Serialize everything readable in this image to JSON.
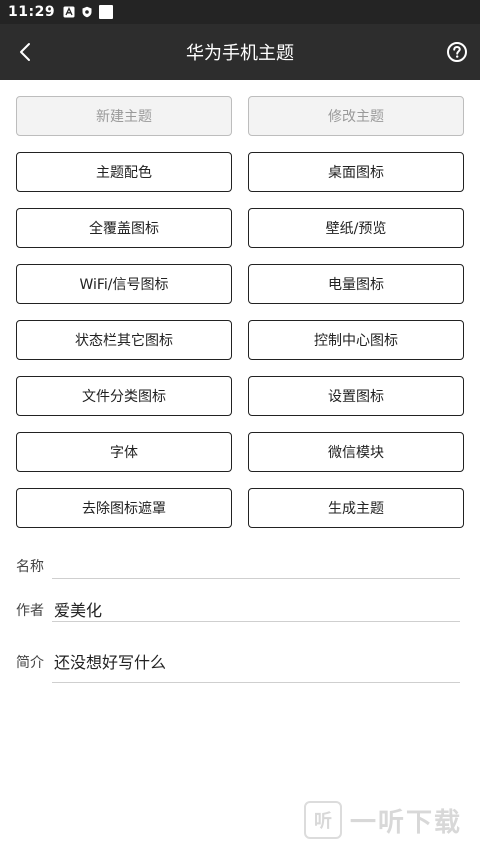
{
  "status_bar": {
    "time": "11:29"
  },
  "app_bar": {
    "title": "华为手机主题"
  },
  "buttons": [
    {
      "label": "新建主题",
      "enabled": false
    },
    {
      "label": "修改主题",
      "enabled": false
    },
    {
      "label": "主题配色",
      "enabled": true
    },
    {
      "label": "桌面图标",
      "enabled": true
    },
    {
      "label": "全覆盖图标",
      "enabled": true
    },
    {
      "label": "壁纸/预览",
      "enabled": true
    },
    {
      "label": "WiFi/信号图标",
      "enabled": true
    },
    {
      "label": "电量图标",
      "enabled": true
    },
    {
      "label": "状态栏其它图标",
      "enabled": true
    },
    {
      "label": "控制中心图标",
      "enabled": true
    },
    {
      "label": "文件分类图标",
      "enabled": true
    },
    {
      "label": "设置图标",
      "enabled": true
    },
    {
      "label": "字体",
      "enabled": true
    },
    {
      "label": "微信模块",
      "enabled": true
    },
    {
      "label": "去除图标遮罩",
      "enabled": true
    },
    {
      "label": "生成主题",
      "enabled": true
    }
  ],
  "form": {
    "name": {
      "label": "名称",
      "value": ""
    },
    "author": {
      "label": "作者",
      "value": "爱美化"
    },
    "intro": {
      "label": "简介",
      "value": "还没想好写什么"
    }
  },
  "watermark": {
    "icon_char": "听",
    "text": "一听下载"
  }
}
